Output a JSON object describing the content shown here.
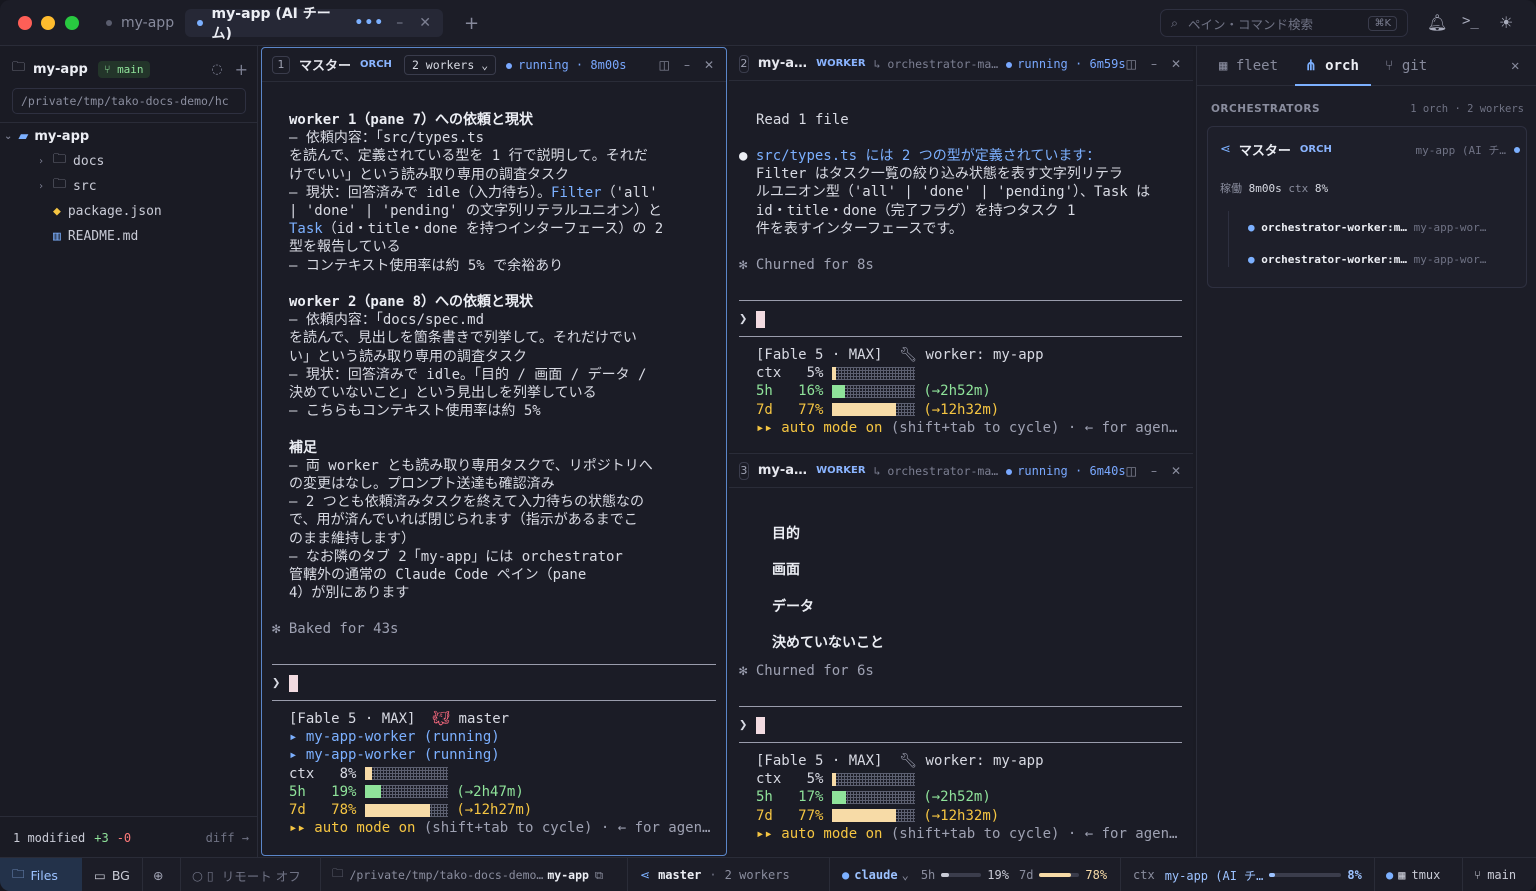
{
  "window": {
    "tab_inactive": "my-app",
    "tab_active": "my-app (AI チーム)",
    "new_tab": "+",
    "search_placeholder": "ペイン・コマンド検索",
    "search_kbd": "⌘K"
  },
  "sidebar": {
    "project": "my-app",
    "branch": "main",
    "path": "/private/tmp/tako-docs-demo/hc",
    "root": "my-app",
    "items": [
      {
        "label": "docs",
        "kind": "folder"
      },
      {
        "label": "src",
        "kind": "folder"
      },
      {
        "label": "package.json",
        "kind": "file"
      },
      {
        "label": "README.md",
        "kind": "file"
      }
    ],
    "modified": "1 modified",
    "added": "+3",
    "removed": "-0",
    "diff": "diff →"
  },
  "pane1": {
    "num": "1",
    "title": "マスター",
    "badge": "ORCH",
    "workers": "2 workers",
    "status": "running",
    "time": "8m00s",
    "lines": [
      "worker 1（pane 7）への依頼と現状",
      "– 依頼内容：「src/types.ts",
      "を読んで、定義されている型を 1 行で説明して。それだ",
      "けでいい」という読み取り専用の調査タスク",
      "– 現状：回答済みで idle（入力待ち）。Filter（'all'",
      "| 'done' | 'pending' の文字列リテラルユニオン）と",
      "Task（id・title・done を持つインターフェース）の 2",
      "型を報告している",
      "– コンテキスト使用率は約 5% で余裕あり",
      "",
      "worker 2（pane 8）への依頼と現状",
      "– 依頼内容：「docs/spec.md",
      "を読んで、見出しを箇条書きで列挙して。それだけでい",
      "い」という読み取り専用の調査タスク",
      "– 現状：回答済みで idle。「目的 / 画面 / データ /",
      "決めていないこと」という見出しを列挙している",
      "– こちらもコンテキスト使用率は約 5%",
      "",
      "補足",
      "– 両 worker とも読み取り専用タスクで、リポジトリへ",
      "の変更はなし。プロンプト送達も確認済み",
      "– 2 つとも依頼済みタスクを終えて入力待ちの状態なの",
      "で、用が済んでいれば閉じられます（指示があるまでこ",
      "のまま維持します）",
      "– なお隣のタブ 2「my-app」には orchestrator",
      "管轄外の通常の Claude Code ペイン（pane",
      "4）が別にあります"
    ],
    "baked": "✻ Baked for 43s",
    "prompt": "❯",
    "footer_model": "[Fable 5 · MAX]",
    "footer_role": "master",
    "worker_a": "▸ my-app-worker (running)",
    "worker_b": "▸ my-app-worker (running)",
    "ctx_label": "ctx",
    "ctx_val": "8%",
    "h5_label": "5h",
    "h5_val": "19%",
    "h5_reset": "(→2h47m)",
    "d7_label": "7d",
    "d7_val": "78%",
    "d7_reset": "(→12h27m)",
    "auto": "▸▸ auto mode on",
    "auto_hint": "(shift+tab to cycle) · ← for agen…"
  },
  "pane2": {
    "num": "2",
    "title": "my-a…",
    "badge": "WORKER",
    "parent": "↳ orchestrator-ma…",
    "status": "running",
    "time": "6m59s",
    "read": "Read 1 file",
    "lines": [
      "src/types.ts には 2 つの型が定義されています：",
      "Filter はタスク一覧の絞り込み状態を表す文字列リテラ",
      "ルユニオン型（'all' | 'done' | 'pending'）、Task は",
      "id・title・done（完了フラグ）を持つタスク 1",
      "件を表すインターフェースです。"
    ],
    "churned": "✻ Churned for 8s",
    "prompt": "❯",
    "footer_model": "[Fable 5 · MAX]",
    "footer_role": "worker: my-app",
    "ctx_label": "ctx",
    "ctx_val": "5%",
    "h5_label": "5h",
    "h5_val": "16%",
    "h5_reset": "(→2h52m)",
    "d7_label": "7d",
    "d7_val": "77%",
    "d7_reset": "(→12h32m)",
    "auto": "▸▸ auto mode on",
    "auto_hint": "(shift+tab to cycle) · ← for agen…"
  },
  "pane3": {
    "num": "3",
    "title": "my-a…",
    "badge": "WORKER",
    "parent": "↳ orchestrator-ma…",
    "status": "running",
    "time": "6m40s",
    "headings": [
      "目的",
      "画面",
      "データ",
      "決めていないこと"
    ],
    "churned": "✻ Churned for 6s",
    "prompt": "❯",
    "footer_model": "[Fable 5 · MAX]",
    "footer_role": "worker: my-app",
    "ctx_label": "ctx",
    "ctx_val": "5%",
    "h5_label": "5h",
    "h5_val": "17%",
    "h5_reset": "(→2h52m)",
    "d7_label": "7d",
    "d7_val": "77%",
    "d7_reset": "(→12h32m)",
    "auto": "▸▸ auto mode on",
    "auto_hint": "(shift+tab to cycle) · ← for agen…"
  },
  "right": {
    "tabs": [
      "fleet",
      "orch",
      "git"
    ],
    "section": "ORCHESTRATORS",
    "summary": "1 orch · 2 workers",
    "card_title": "マスター",
    "card_badge": "ORCH",
    "card_app": "my-app (AI チ…",
    "uptime_label": "稼働",
    "uptime": "8m00s",
    "ctx_label": "ctx",
    "ctx": "8%",
    "workers": [
      {
        "name": "orchestrator-worker:m…",
        "app": "my-app-wor…"
      },
      {
        "name": "orchestrator-worker:m…",
        "app": "my-app-wor…"
      }
    ]
  },
  "status": {
    "files": "Files",
    "bg": "BG",
    "remote": "リモート オフ",
    "path": "/private/tmp/tako-docs-demo…",
    "app": "my-app",
    "master": "master",
    "workers": "2 workers",
    "claude": "claude",
    "h5": "5h",
    "h5_val": "19%",
    "d7": "7d",
    "d7_val": "78%",
    "ctx": "ctx",
    "ctx_app": "my-app (AI チ…",
    "ctx_val": "8%",
    "tmux": "tmux",
    "branch": "main"
  },
  "usage": {
    "pane1_ctx": 0.08,
    "pane1_5h": 0.19,
    "pane1_7d": 0.78,
    "pane2_ctx": 0.05,
    "pane2_5h": 0.16,
    "pane2_7d": 0.77,
    "pane3_ctx": 0.05,
    "pane3_5h": 0.17,
    "pane3_7d": 0.77
  },
  "colors": {
    "accent": "#7cb0ff",
    "green_fill": "#8fe39a",
    "yellow_fill": "#f7dba7",
    "running": "#79a8ff"
  }
}
